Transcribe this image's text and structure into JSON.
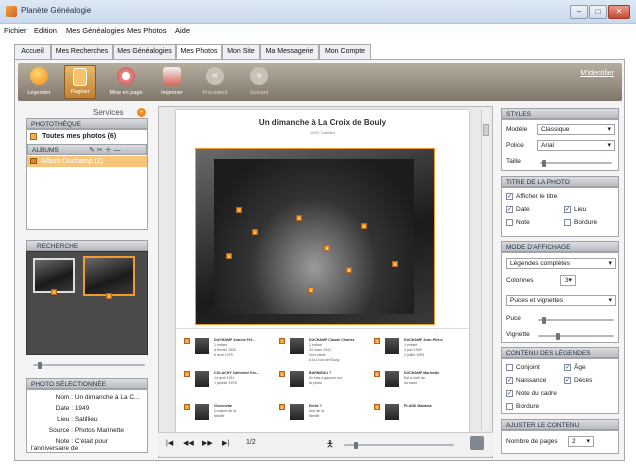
{
  "window": {
    "title": "Planète Généalogie",
    "minimize": "–",
    "maximize": "□",
    "close": "✕"
  },
  "menu": [
    "Fichier",
    "Edition",
    "Mes Généalogies",
    "Mes Photos",
    "Aide"
  ],
  "tabs": [
    "Accueil",
    "Mes Recherches",
    "Mes Généalogies",
    "Mes Photos",
    "Mon Site",
    "Ma Messagerie",
    "Mon Compte"
  ],
  "active_tab": "Mes Photos",
  "toolbar": {
    "buttons": [
      "Légender",
      "Paginer",
      "Mise en page",
      "Imprimer",
      "Précédent",
      "Suivant"
    ],
    "identifier": "M'identifier"
  },
  "services": "Services",
  "phototheque": {
    "header": "PHOTOTHÈQUE",
    "all": "Toutes mes photos (6)",
    "albums_header": "ALBUMS",
    "album": "Album Duchamp (2)"
  },
  "recherche": {
    "header": "RECHERCHE",
    "thumb_badges": [
      "1",
      "2"
    ]
  },
  "selected": {
    "header": "PHOTO SÉLECTIONNÉE",
    "fields": [
      {
        "k": "Nom :",
        "v": "Un dimanche à La C..."
      },
      {
        "k": "Date :",
        "v": "1949"
      },
      {
        "k": "Lieu :",
        "v": "Satillieu"
      },
      {
        "k": "Source :",
        "v": "Photos Marinette"
      },
      {
        "k": "Note :",
        "v": "C'était pour l'anniversaire de"
      }
    ]
  },
  "page": {
    "title": "Un dimanche à La Croix de Bouly",
    "subtitle": "1949, Satillieu",
    "pager": "1/2",
    "people": [
      {
        "n": "1",
        "name": "DUCHAMP Jeanne Fél...",
        "info": "1 enfant\n6 février 1932\n6 avril 1979"
      },
      {
        "n": "2",
        "name": "DUCHAMP Claude Charles",
        "info": "1 enfant\n24 mars 1941\nNon marié\nA la Croix de Bouly"
      },
      {
        "n": "3",
        "name": "DUCHAMP Jean-Pierre",
        "info": "1 enfant\n4 juin 1939\n2 juillet 1993"
      },
      {
        "n": "4",
        "name": "COLACHY Catherine Em...",
        "info": "14 avril 1911\n1 janvier 1978"
      },
      {
        "n": "5",
        "name": "BARNIEAU ?",
        "info": "En bas à gauche sur\nla photo"
      },
      {
        "n": "6",
        "name": "DUCHAMP Marinette",
        "info": "Est à côté de\nsa sœur"
      },
      {
        "n": "7",
        "name": "Vincenette",
        "info": "Cousine de la\nfamille"
      },
      {
        "n": "8",
        "name": "Emile ?",
        "info": "Ami de la\nfamille"
      },
      {
        "n": "9",
        "name": "PLANK Madame",
        "info": ""
      }
    ]
  },
  "styles": {
    "header": "STYLES",
    "modele_label": "Modèle",
    "modele": "Classique",
    "police_label": "Police",
    "police": "Arial",
    "taille_label": "Taille"
  },
  "titre": {
    "header": "TITRE DE LA PHOTO",
    "afficher": "Afficher le titre",
    "date": "Date",
    "lieu": "Lieu",
    "note": "Note",
    "bordure": "Bordure",
    "checked": {
      "afficher": true,
      "date": true,
      "lieu": true,
      "note": false,
      "bordure": false
    }
  },
  "affichage": {
    "header": "MODE D'AFFICHAGE",
    "legendes": "Légendes complètes",
    "colonnes_label": "Colonnes",
    "colonnes": "3",
    "puces": "Puces et vignettes",
    "puce_label": "Puce",
    "vignette_label": "Vignette"
  },
  "contenu": {
    "header": "CONTENU DES LÉGENDES",
    "conjoint": "Conjoint",
    "age": "Âge",
    "naissance": "Naissance",
    "deces": "Décès",
    "note_cadre": "Note du cadre",
    "bordure": "Bordure",
    "checked": {
      "conjoint": false,
      "age": true,
      "naissance": true,
      "deces": true,
      "note_cadre": true,
      "bordure": false
    }
  },
  "ajuster": {
    "header": "AJUSTER LE CONTENU",
    "pages_label": "Nombre de pages",
    "pages": "2"
  }
}
